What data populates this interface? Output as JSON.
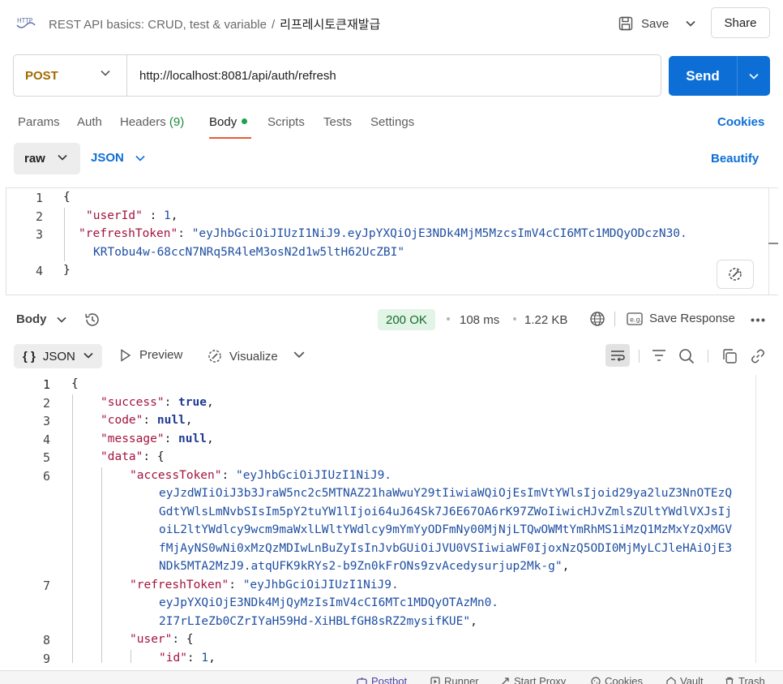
{
  "header": {
    "breadcrumb_parent": "REST API basics: CRUD, test & variable",
    "breadcrumb_sep": "/",
    "breadcrumb_current": "리프레시토큰재발급",
    "save_label": "Save",
    "share_label": "Share",
    "http_icon": "http-icon"
  },
  "request": {
    "method": "POST",
    "url": "http://localhost:8081/api/auth/refresh",
    "send_label": "Send"
  },
  "request_tabs": {
    "params": "Params",
    "auth": "Auth",
    "headers": "Headers",
    "headers_count": "(9)",
    "body": "Body",
    "scripts": "Scripts",
    "tests": "Tests",
    "settings": "Settings",
    "cookies": "Cookies"
  },
  "body_mode": {
    "raw": "raw",
    "format": "JSON",
    "beautify": "Beautify"
  },
  "request_body": {
    "line_numbers": [
      "1",
      "2",
      "3",
      "4"
    ],
    "l1_open": "{",
    "l2_key": "\"userId\"",
    "l2_sep": " : ",
    "l2_val": "1",
    "l2_comma": ",",
    "l3_key": "\"refreshToken\"",
    "l3_sep": ": ",
    "l3_val_a": "\"eyJhbGciOiJIUzI1NiJ9.eyJpYXQiOjE3NDk4MjM5MzcsImV4cCI6MTc1MDQyODczN30.",
    "l3_val_b": "KRTobu4w-68ccN7NRq5R4leM3osN2d1w5ltH62UcZBI\"",
    "l4_close": "}"
  },
  "response_bar": {
    "body_label": "Body",
    "status": "200 OK",
    "time": "108 ms",
    "size": "1.22 KB",
    "save_response": "Save Response"
  },
  "response_toolbar": {
    "format": "JSON",
    "format_brace": "{ }",
    "preview": "Preview",
    "visualize": "Visualize"
  },
  "response_body": {
    "line_numbers": [
      "1",
      "2",
      "3",
      "4",
      "5",
      "6",
      "7",
      "8",
      "9"
    ],
    "l1": "{",
    "success_key": "\"success\"",
    "success_val": "true",
    "code_key": "\"code\"",
    "code_val": "null",
    "message_key": "\"message\"",
    "message_val": "null",
    "data_key": "\"data\"",
    "data_open": "{",
    "access_key": "\"accessToken\"",
    "access_lines": [
      "\"eyJhbGciOiJIUzI1NiJ9.",
      "eyJzdWIiOiJ3b3JraW5nc2c5MTNAZ21haWwuY29tIiwiaWQiOjEsImVtYWlsIjoid29ya2luZ3NnOTEzQ",
      "GdtYWlsLmNvbSIsIm5pY2tuYW1lIjoi64uJ64Sk7J6E67OA6rK97ZWoIiwicHJvZmlsZUltYWdlVXJsIj",
      "oiL2ltYWdlcy9wcm9maWxlLWltYWdlcy9mYmYyODFmNy00MjNjLTQwOWMtYmRhMS1iMzQ1MzMxYzQxMGV",
      "fMjAyNS0wNi0xMzQzMDIwLnBuZyIsInJvbGUiOiJVU0VSIiwiaWF0IjoxNzQ5ODI0MjMyLCJleHAiOjE3",
      "NDk5MTA2MzJ9.atqUFK9kRYs2-b9Zn0kFrONs9zvAcedysurjup2Mk-g\""
    ],
    "refresh_key": "\"refreshToken\"",
    "refresh_lines": [
      "\"eyJhbGciOiJIUzI1NiJ9.",
      "eyJpYXQiOjE3NDk4MjQyMzIsImV4cCI6MTc1MDQyOTAzMn0.",
      "2I7rLIeZb0CZrIYaH59Hd-XiHBLfGH8sRZ2mysifKUE\""
    ],
    "user_key": "\"user\"",
    "user_open": "{",
    "id_key": "\"id\"",
    "id_val": "1"
  },
  "statusbar": {
    "postbot": "Postbot",
    "runner": "Runner",
    "start_proxy": "Start Proxy",
    "cookies": "Cookies",
    "vault": "Vault",
    "trash": "Trash"
  },
  "colors": {
    "accent": "#0d6fd6",
    "method": "#a16b00",
    "status_ok_bg": "#e2f4e5",
    "status_ok_text": "#146c2e",
    "json_key": "#a3133d",
    "json_string": "#1f4fa3",
    "tab_underline": "#e85c39"
  }
}
